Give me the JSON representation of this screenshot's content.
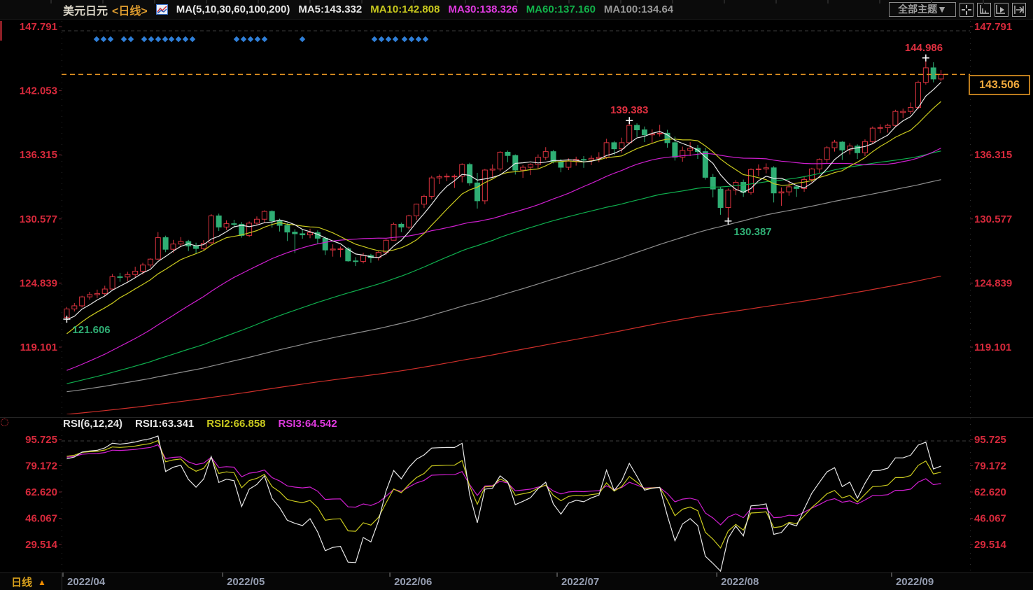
{
  "topbar": {
    "symbol": "美元日元",
    "period_tag": "<日线>",
    "ma_group_label": "MA(5,10,30,60,100,200)",
    "ma_values": [
      {
        "label": "MA5:143.332",
        "color": "#e8e8e8"
      },
      {
        "label": "MA10:142.808",
        "color": "#c9c91e"
      },
      {
        "label": "MA30:138.326",
        "color": "#e03ae0"
      },
      {
        "label": "MA60:137.160",
        "color": "#12b24a"
      },
      {
        "label": "MA100:134.64",
        "color": "#9a9a9a"
      }
    ],
    "theme_button": "全部主题▼"
  },
  "rsi_header": {
    "group_label": "RSI(6,12,24)",
    "values": [
      {
        "label": "RSI1:63.341",
        "color": "#e8e8e8"
      },
      {
        "label": "RSI2:66.858",
        "color": "#c9c91e"
      },
      {
        "label": "RSI3:64.542",
        "color": "#e03ae0"
      }
    ]
  },
  "footer": {
    "period_label": "日线",
    "arrow": "▲"
  },
  "price_tag": {
    "text": "143.506"
  },
  "chart_data": {
    "type": "candlestick",
    "title": "美元日元 日线",
    "main_axis_labels": [
      "147.791",
      "142.053",
      "136.315",
      "130.577",
      "124.839",
      "119.101"
    ],
    "rsi_axis_labels": [
      "95.725",
      "79.172",
      "62.620",
      "46.067",
      "29.514"
    ],
    "month_ticks": [
      {
        "label": "2022/04",
        "day": 0
      },
      {
        "label": "2022/05",
        "day": 21
      },
      {
        "label": "2022/06",
        "day": 43
      },
      {
        "label": "2022/07",
        "day": 65
      },
      {
        "label": "2022/08",
        "day": 86
      },
      {
        "label": "2022/09",
        "day": 109
      }
    ],
    "last_price": 143.506,
    "colors": {
      "up": "#d8323e",
      "down": "#2fae74",
      "last_price_line": "#e59422",
      "axis_label": "#d6293b",
      "date_label": "#959db0",
      "event_dot": "#2f7fd8",
      "grid_dash": "#3c3c3c",
      "marker_cross": "#ffffff"
    },
    "ma_lines": [
      {
        "n": 200,
        "color": "#ce2f2a"
      },
      {
        "n": 100,
        "color": "#8f8f8f"
      },
      {
        "n": 60,
        "color": "#0faf4e"
      },
      {
        "n": 30,
        "color": "#cf1ecf"
      },
      {
        "n": 10,
        "color": "#c9c91e"
      },
      {
        "n": 5,
        "color": "#e8e8e8"
      }
    ],
    "rsi_lines": [
      {
        "n": 24,
        "color": "#cf1ecf"
      },
      {
        "n": 12,
        "color": "#c9c91e"
      },
      {
        "n": 6,
        "color": "#e8e8e8"
      }
    ],
    "annotations": [
      {
        "text": "144.986",
        "price": 144.986,
        "day": 113,
        "placement": "above",
        "color": "#e03040"
      },
      {
        "text": "139.383",
        "price": 139.383,
        "day": 74,
        "placement": "above",
        "color": "#e03040"
      },
      {
        "text": "130.387",
        "price": 130.387,
        "day": 87,
        "placement": "below",
        "color": "#2fae74"
      },
      {
        "text": "121.606",
        "price": 121.606,
        "day": 0,
        "placement": "below",
        "color": "#2fae74"
      }
    ],
    "event_dot_xs": [
      138,
      148,
      158,
      177,
      187,
      206,
      216,
      226,
      236,
      245,
      255,
      265,
      275,
      338,
      348,
      358,
      368,
      378,
      432,
      535,
      545,
      555,
      565,
      578,
      588,
      598,
      608
    ],
    "prehistory_anchors": [
      [
        -200,
        110.2
      ],
      [
        -185,
        110.8
      ],
      [
        -170,
        109.7
      ],
      [
        -155,
        109.9
      ],
      [
        -140,
        110.2
      ],
      [
        -125,
        111.3
      ],
      [
        -115,
        113.6
      ],
      [
        -105,
        114.2
      ],
      [
        -95,
        113.7
      ],
      [
        -85,
        115.3
      ],
      [
        -78,
        113.9
      ],
      [
        -68,
        113.4
      ],
      [
        -58,
        113.7
      ],
      [
        -48,
        114.9
      ],
      [
        -42,
        115.3
      ],
      [
        -36,
        114.4
      ],
      [
        -30,
        115.1
      ],
      [
        -24,
        114.9
      ],
      [
        -18,
        115.3
      ],
      [
        -13,
        115.6
      ],
      [
        -9,
        117.5
      ],
      [
        -6,
        119.8
      ],
      [
        -4,
        121.3
      ],
      [
        -3,
        120.4
      ],
      [
        -2,
        121.9
      ],
      [
        -1,
        121.7
      ]
    ],
    "candles": [
      [
        121.75,
        122.7,
        121.606,
        122.52
      ],
      [
        122.52,
        123.05,
        122.3,
        122.8
      ],
      [
        122.8,
        123.7,
        122.65,
        123.6
      ],
      [
        123.6,
        124.05,
        123.35,
        123.8
      ],
      [
        123.8,
        124.25,
        123.5,
        123.9
      ],
      [
        123.9,
        124.6,
        123.65,
        124.3
      ],
      [
        124.3,
        125.65,
        124.25,
        125.4
      ],
      [
        125.4,
        125.75,
        124.95,
        125.38
      ],
      [
        125.38,
        125.85,
        125.0,
        125.6
      ],
      [
        125.6,
        126.3,
        125.35,
        125.9
      ],
      [
        125.9,
        126.65,
        125.6,
        126.45
      ],
      [
        126.45,
        127.05,
        126.2,
        126.98
      ],
      [
        126.98,
        129.4,
        126.92,
        128.9
      ],
      [
        128.9,
        129.08,
        127.6,
        127.86
      ],
      [
        127.86,
        128.7,
        127.55,
        128.33
      ],
      [
        128.33,
        128.95,
        128.05,
        128.55
      ],
      [
        128.55,
        128.7,
        127.7,
        128.15
      ],
      [
        128.15,
        128.45,
        127.45,
        127.93
      ],
      [
        127.93,
        128.68,
        127.8,
        128.4
      ],
      [
        128.44,
        131.0,
        128.34,
        130.85
      ],
      [
        130.85,
        131.05,
        129.5,
        129.85
      ],
      [
        129.85,
        130.45,
        129.6,
        130.15
      ],
      [
        130.15,
        130.5,
        129.8,
        130.1
      ],
      [
        130.1,
        130.3,
        128.9,
        129.1
      ],
      [
        129.1,
        130.35,
        128.95,
        130.2
      ],
      [
        130.2,
        130.8,
        130.0,
        130.55
      ],
      [
        130.55,
        131.35,
        130.25,
        131.25
      ],
      [
        131.25,
        131.34,
        129.8,
        130.4
      ],
      [
        130.4,
        130.6,
        129.45,
        130.0
      ],
      [
        130.0,
        130.2,
        128.6,
        129.4
      ],
      [
        129.4,
        129.65,
        127.52,
        129.25
      ],
      [
        129.25,
        129.6,
        128.8,
        129.15
      ],
      [
        129.15,
        129.7,
        128.85,
        129.35
      ],
      [
        129.35,
        129.55,
        128.35,
        128.85
      ],
      [
        128.85,
        129.0,
        127.35,
        127.8
      ],
      [
        127.8,
        128.3,
        127.2,
        127.88
      ],
      [
        127.88,
        128.1,
        127.15,
        127.9
      ],
      [
        127.9,
        128.05,
        126.75,
        126.82
      ],
      [
        126.82,
        127.15,
        126.36,
        126.78
      ],
      [
        126.78,
        127.55,
        126.6,
        127.3
      ],
      [
        127.3,
        127.45,
        126.65,
        127.1
      ],
      [
        127.1,
        127.7,
        126.85,
        127.58
      ],
      [
        127.58,
        128.75,
        127.35,
        128.67
      ],
      [
        128.67,
        130.25,
        128.65,
        130.1
      ],
      [
        130.1,
        130.25,
        129.4,
        129.85
      ],
      [
        129.85,
        130.95,
        129.65,
        130.85
      ],
      [
        130.85,
        131.95,
        130.45,
        131.9
      ],
      [
        131.9,
        132.75,
        131.55,
        132.6
      ],
      [
        132.6,
        134.45,
        132.35,
        134.25
      ],
      [
        134.25,
        134.55,
        133.7,
        134.35
      ],
      [
        134.35,
        134.65,
        133.95,
        134.4
      ],
      [
        134.4,
        134.55,
        133.35,
        134.4
      ],
      [
        134.4,
        135.55,
        133.85,
        135.45
      ],
      [
        135.45,
        135.6,
        133.55,
        133.8
      ],
      [
        133.8,
        134.7,
        131.5,
        132.2
      ],
      [
        132.2,
        135.05,
        131.9,
        134.95
      ],
      [
        134.95,
        135.45,
        134.3,
        135.05
      ],
      [
        135.05,
        136.65,
        134.85,
        136.55
      ],
      [
        136.55,
        136.7,
        135.65,
        136.25
      ],
      [
        136.25,
        136.35,
        134.55,
        134.95
      ],
      [
        134.95,
        135.4,
        134.25,
        135.2
      ],
      [
        135.2,
        135.55,
        134.5,
        135.45
      ],
      [
        135.45,
        136.35,
        135.1,
        136.1
      ],
      [
        136.1,
        137.0,
        135.85,
        136.6
      ],
      [
        136.6,
        136.75,
        135.55,
        135.7
      ],
      [
        135.7,
        135.95,
        134.75,
        135.2
      ],
      [
        135.2,
        136.0,
        134.95,
        135.75
      ],
      [
        135.75,
        136.15,
        135.35,
        135.9
      ],
      [
        135.9,
        136.2,
        135.15,
        135.85
      ],
      [
        135.85,
        136.25,
        135.4,
        136.0
      ],
      [
        136.0,
        136.55,
        135.65,
        136.1
      ],
      [
        136.1,
        137.75,
        135.95,
        137.4
      ],
      [
        137.4,
        137.55,
        136.3,
        136.85
      ],
      [
        136.85,
        137.85,
        136.5,
        137.4
      ],
      [
        137.4,
        139.383,
        137.25,
        138.95
      ],
      [
        138.95,
        139.13,
        137.9,
        138.55
      ],
      [
        138.55,
        138.85,
        137.45,
        138.1
      ],
      [
        138.1,
        138.6,
        137.35,
        138.2
      ],
      [
        138.2,
        139.0,
        137.95,
        138.25
      ],
      [
        138.25,
        138.55,
        136.95,
        137.4
      ],
      [
        137.4,
        137.95,
        135.8,
        136.1
      ],
      [
        136.1,
        137.05,
        135.7,
        136.7
      ],
      [
        136.7,
        137.45,
        136.2,
        136.9
      ],
      [
        136.9,
        137.2,
        135.95,
        136.6
      ],
      [
        136.6,
        136.95,
        134.1,
        134.3
      ],
      [
        134.3,
        134.6,
        132.5,
        133.25
      ],
      [
        133.25,
        133.45,
        130.95,
        131.6
      ],
      [
        131.6,
        133.3,
        130.387,
        133.15
      ],
      [
        133.15,
        134.05,
        132.7,
        133.85
      ],
      [
        133.85,
        134.1,
        132.55,
        132.95
      ],
      [
        132.95,
        135.1,
        132.75,
        135.0
      ],
      [
        135.0,
        135.45,
        134.4,
        135.05
      ],
      [
        135.05,
        135.55,
        134.65,
        135.15
      ],
      [
        135.15,
        135.3,
        132.05,
        132.9
      ],
      [
        132.9,
        133.4,
        131.75,
        133.0
      ],
      [
        133.0,
        133.9,
        132.65,
        133.45
      ],
      [
        133.45,
        133.6,
        132.55,
        133.3
      ],
      [
        133.3,
        134.35,
        133.0,
        134.1
      ],
      [
        134.1,
        135.15,
        133.85,
        135.05
      ],
      [
        135.05,
        136.0,
        134.7,
        135.9
      ],
      [
        135.9,
        137.1,
        135.6,
        136.95
      ],
      [
        136.95,
        137.65,
        136.6,
        137.45
      ],
      [
        137.45,
        137.55,
        135.85,
        136.75
      ],
      [
        136.75,
        137.35,
        136.35,
        137.1
      ],
      [
        137.1,
        137.25,
        135.95,
        136.5
      ],
      [
        136.5,
        137.7,
        136.2,
        137.5
      ],
      [
        137.5,
        138.85,
        137.25,
        138.7
      ],
      [
        138.7,
        139.05,
        138.25,
        138.75
      ],
      [
        138.75,
        139.1,
        138.3,
        138.95
      ],
      [
        138.95,
        140.35,
        138.8,
        140.2
      ],
      [
        140.1,
        140.45,
        139.6,
        140.2
      ],
      [
        140.2,
        141.0,
        139.95,
        140.55
      ],
      [
        140.55,
        142.95,
        140.4,
        142.8
      ],
      [
        142.8,
        144.986,
        142.6,
        144.1
      ],
      [
        144.1,
        144.6,
        142.8,
        143.1
      ],
      [
        143.1,
        143.9,
        142.9,
        143.506
      ]
    ]
  }
}
